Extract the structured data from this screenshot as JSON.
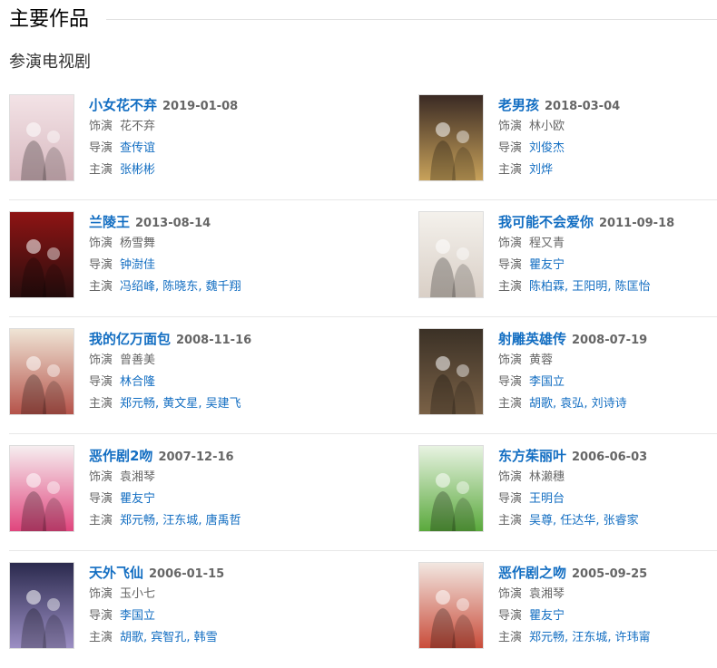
{
  "section": {
    "title": "主要作品"
  },
  "subsection": {
    "title": "参演电视剧"
  },
  "labels": {
    "role": "饰演",
    "director": "导演",
    "star": "主演"
  },
  "works": [
    {
      "title": "小女花不弃",
      "date": "2019-01-08",
      "role": "花不弃",
      "directors": [
        "查传谊"
      ],
      "stars": [
        "张彬彬"
      ],
      "poster_colors": [
        "#f3e3e6",
        "#d8b9c0"
      ]
    },
    {
      "title": "老男孩",
      "date": "2018-03-04",
      "role": "林小欧",
      "directors": [
        "刘俊杰"
      ],
      "stars": [
        "刘烨"
      ],
      "poster_colors": [
        "#3a2a24",
        "#c8a25a"
      ]
    },
    {
      "title": "兰陵王",
      "date": "2013-08-14",
      "role": "杨雪舞",
      "directors": [
        "钟澍佳"
      ],
      "stars": [
        "冯绍峰",
        "陈晓东",
        "魏千翔"
      ],
      "poster_colors": [
        "#8e1414",
        "#2a0e0e"
      ]
    },
    {
      "title": "我可能不会爱你",
      "date": "2011-09-18",
      "role": "程又青",
      "directors": [
        "瞿友宁"
      ],
      "stars": [
        "陈柏霖",
        "王阳明",
        "陈匡怡"
      ],
      "poster_colors": [
        "#f4f1ec",
        "#d9cfc6"
      ]
    },
    {
      "title": "我的亿万面包",
      "date": "2008-11-16",
      "role": "曾善美",
      "directors": [
        "林合隆"
      ],
      "stars": [
        "郑元畅",
        "黄文星",
        "吴建飞"
      ],
      "poster_colors": [
        "#efe4d5",
        "#b5534a"
      ]
    },
    {
      "title": "射雕英雄传",
      "date": "2008-07-19",
      "role": "黄蓉",
      "directors": [
        "李国立"
      ],
      "stars": [
        "胡歌",
        "袁弘",
        "刘诗诗"
      ],
      "poster_colors": [
        "#3b3126",
        "#7a6146"
      ]
    },
    {
      "title": "恶作剧2吻",
      "date": "2007-12-16",
      "role": "袁湘琴",
      "directors": [
        "瞿友宁"
      ],
      "stars": [
        "郑元畅",
        "汪东城",
        "唐禹哲"
      ],
      "poster_colors": [
        "#f6eef0",
        "#e0457d"
      ]
    },
    {
      "title": "东方茱丽叶",
      "date": "2006-06-03",
      "role": "林濑穗",
      "directors": [
        "王明台"
      ],
      "stars": [
        "吴尊",
        "任达华",
        "张睿家"
      ],
      "poster_colors": [
        "#e8f3e2",
        "#5aa93c"
      ]
    },
    {
      "title": "天外飞仙",
      "date": "2006-01-15",
      "role": "玉小七",
      "directors": [
        "李国立"
      ],
      "stars": [
        "胡歌",
        "宾智孔",
        "韩雪"
      ],
      "poster_colors": [
        "#2b2a4e",
        "#9c8fc4"
      ]
    },
    {
      "title": "恶作剧之吻",
      "date": "2005-09-25",
      "role": "袁湘琴",
      "directors": [
        "瞿友宁"
      ],
      "stars": [
        "郑元畅",
        "汪东城",
        "许玮甯"
      ],
      "poster_colors": [
        "#f2e7e1",
        "#c94c3a"
      ]
    }
  ]
}
